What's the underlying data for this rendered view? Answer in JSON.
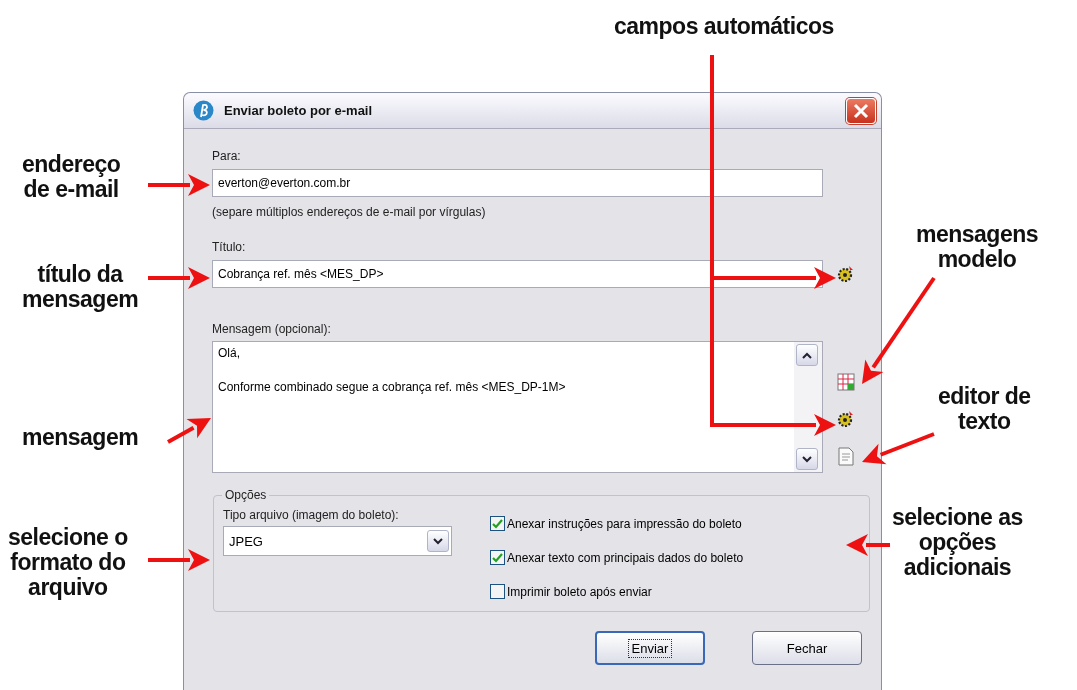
{
  "annotations": [
    {
      "text": "campos automáticos"
    },
    {
      "text": "endereço\nde e-mail"
    },
    {
      "text": "mensagens\nmodelo"
    },
    {
      "text": "título da\nmensagem"
    },
    {
      "text": "editor de\ntexto"
    },
    {
      "text": "mensagem"
    },
    {
      "text": "selecione o\nformato do\narquivo"
    },
    {
      "text": "selecione as\nopções\nadicionais"
    }
  ],
  "dialog": {
    "title": "Enviar boleto por e-mail",
    "to_label": "Para:",
    "to_value": "everton@everton.com.br",
    "to_hint": "(separe múltiplos endereços de e-mail por vírgulas)",
    "subject_label": "Título:",
    "subject_value": "Cobrança ref. mês <MES_DP>",
    "message_label": "Mensagem (opcional):",
    "message_value": "Olá,\n\nConforme combinado segue a cobrança ref. mês <MES_DP-1M>",
    "options_legend": "Opções",
    "file_type_label": "Tipo arquivo (imagem do boleto):",
    "file_type_value": "JPEG",
    "checkboxes": [
      {
        "label": "Anexar instruções para impressão do boleto",
        "checked": true
      },
      {
        "label": "Anexar texto com principais dados do boleto",
        "checked": true
      },
      {
        "label": "Imprimir boleto após enviar",
        "checked": false
      }
    ],
    "buttons": [
      {
        "label": "Enviar",
        "default": true
      },
      {
        "label": "Fechar",
        "default": false
      }
    ]
  }
}
